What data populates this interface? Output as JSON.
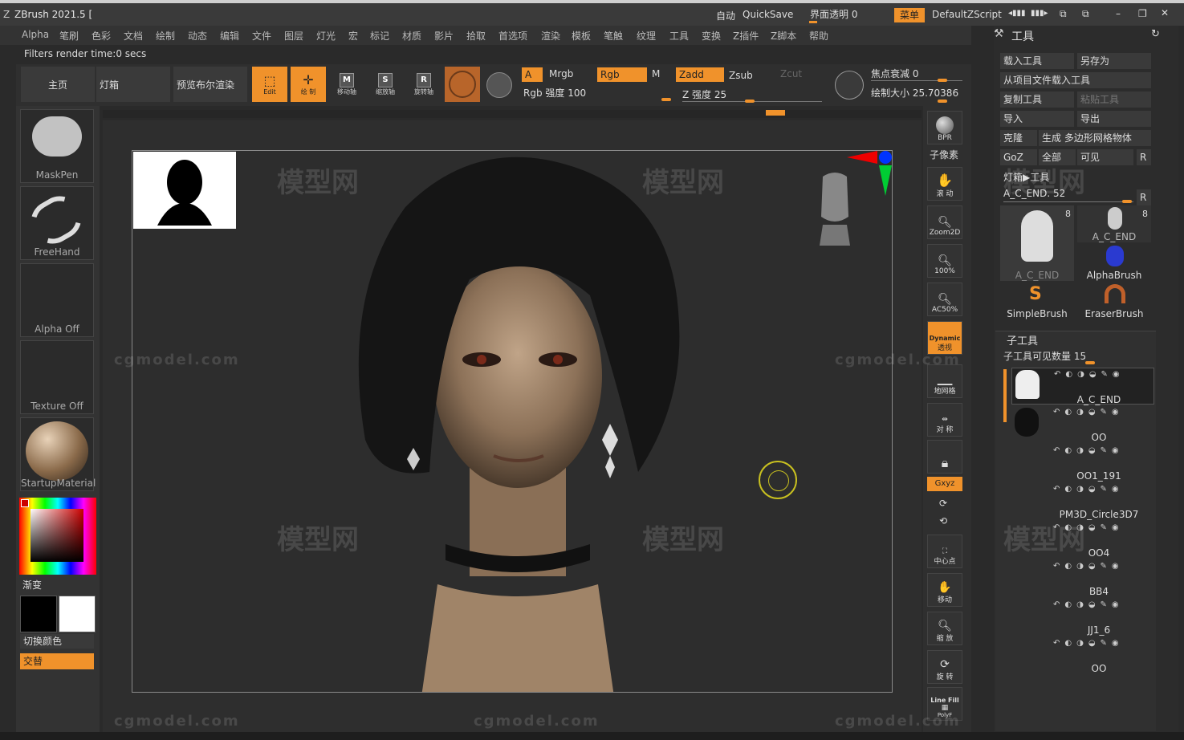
{
  "app": {
    "title": "ZBrush 2021.5 [",
    "auto_label": "自动",
    "quicksave": "QuickSave",
    "ui_transparency": "界面透明 0",
    "menu_btn": "菜单",
    "script": "DefaultZScript"
  },
  "menu": [
    "Alpha",
    "笔刷",
    "色彩",
    "文档",
    "绘制",
    "动态",
    "编辑",
    "文件",
    "图层",
    "灯光",
    "宏",
    "标记",
    "材质",
    "影片",
    "拾取",
    "首选项",
    "渲染",
    "模板",
    "笔触",
    "纹理",
    "工具",
    "变换",
    "Z插件",
    "Z脚本",
    "帮助"
  ],
  "status": "Filters render time:0 secs",
  "toolbar": {
    "home": "主页",
    "lightbox": "灯箱",
    "preview_bpr": "预览布尔渲染",
    "edit": "Edit",
    "draw": "绘 制",
    "move": "移动轴",
    "scale": "缩放轴",
    "rotate": "旋转轴",
    "a_label": "A",
    "mrgb": "Mrgb",
    "rgb": "Rgb",
    "m": "M",
    "zadd": "Zadd",
    "zsub": "Zsub",
    "zcut": "Zcut",
    "rgb_intensity": "Rgb 强度 100",
    "z_intensity": "Z 强度 25",
    "focal_shift": "焦点衰减 0",
    "draw_size": "绘制大小 25.70386"
  },
  "left_panel": {
    "brush1": "MaskPen",
    "stroke": "FreeHand",
    "alpha": "Alpha Off",
    "texture": "Texture Off",
    "material": "StartupMaterial",
    "gradient": "渐变",
    "switch_color": "切换颜色",
    "alternate": "交替"
  },
  "right_strip": {
    "bpr": "BPR",
    "subpixel": "子像素",
    "scroll": "滚 动",
    "zoom2d": "Zoom2D",
    "p100": "100%",
    "ac50": "AC50%",
    "dynamic": "Dynamic",
    "persp": "透视",
    "floor": "地网格",
    "sym": "对 称",
    "xyz": "Gxyz",
    "center": "中心点",
    "move": "移动",
    "zoom": "缩 放",
    "rotate": "旋 转",
    "linefill": "Line Fill",
    "polyf": "PolyF"
  },
  "tool_panel": {
    "header": "工具",
    "load_tool": "载入工具",
    "save_as": "另存为",
    "load_from_project": "从项目文件载入工具",
    "copy_tool": "复制工具",
    "paste_tool": "粘贴工具",
    "import": "导入",
    "export": "导出",
    "clone": "克隆",
    "make_polymesh": "生成 多边形网格物体",
    "goz": "GoZ",
    "all": "全部",
    "visible": "可见",
    "r": "R",
    "lightbox_tool": "灯箱▶工具",
    "current_tool": "A_C_END. 52",
    "tools": [
      {
        "name": "A_C_END",
        "count": "8"
      },
      {
        "name": "A_C_END",
        "count": "8"
      },
      {
        "name": "AlphaBrush",
        "count": ""
      },
      {
        "name": "SimpleBrush",
        "count": ""
      },
      {
        "name": "EraserBrush",
        "count": ""
      }
    ],
    "subtool_header": "子工具",
    "subtool_visible": "子工具可见数量 15",
    "subtools": [
      "A_C_END",
      "OO",
      "OO1_191",
      "PM3D_Circle3D7",
      "OO4",
      "BB4",
      "JJ1_6",
      "OO"
    ]
  },
  "watermarks": {
    "cn": "模型网",
    "en": "cgmodel.com"
  },
  "colors": {
    "accent": "#f0922b",
    "panel": "#333333",
    "canvas": "#2d2d2d"
  }
}
